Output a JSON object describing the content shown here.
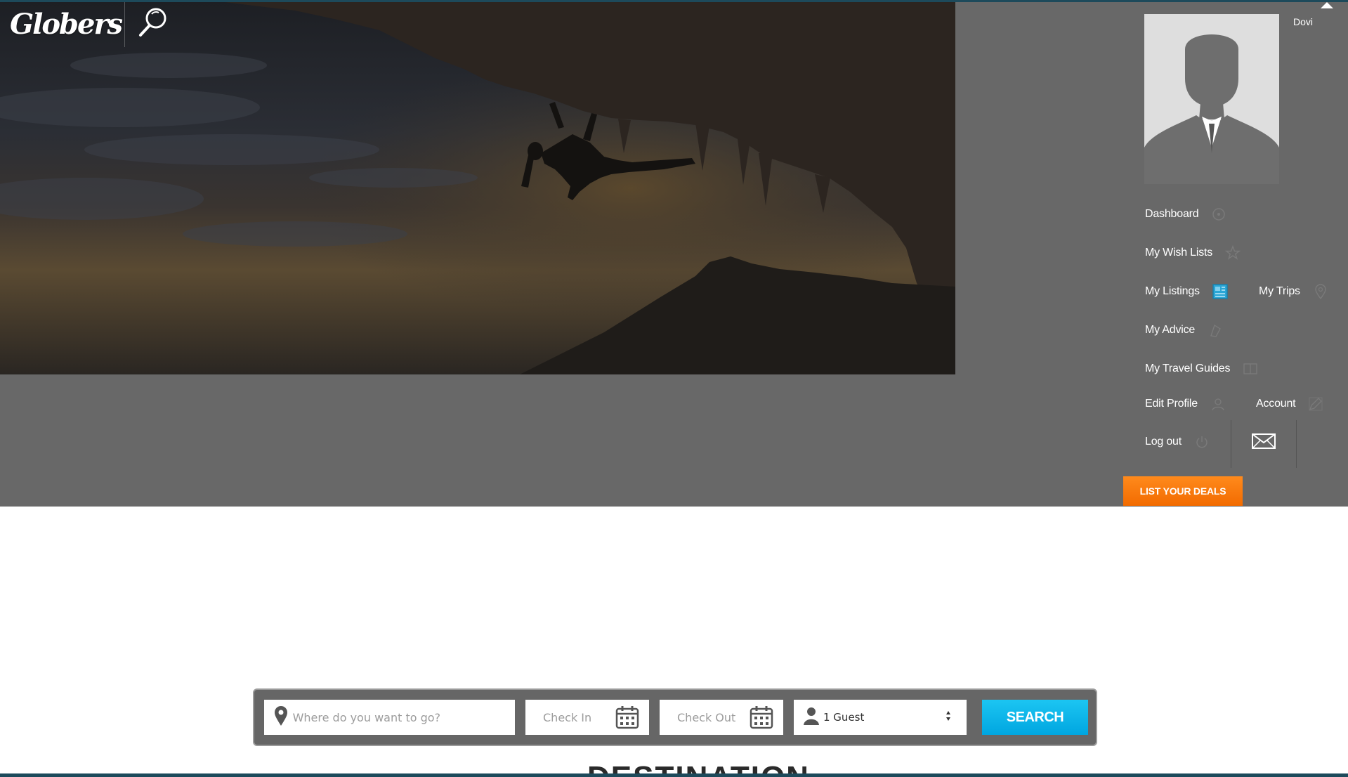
{
  "header": {
    "logo_text": "Globers"
  },
  "account_menu": {
    "username": "Dovi",
    "items": [
      {
        "label": "Dashboard",
        "icon": "gauge-icon"
      },
      {
        "label": "My Wish Lists",
        "icon": "star-icon"
      },
      {
        "label": "My Listings",
        "icon": "listing-icon"
      },
      {
        "label": "My Trips",
        "icon": "map-pin-icon"
      },
      {
        "label": "My Advice",
        "icon": "bookmark-icon"
      },
      {
        "label": "My Travel Guides",
        "icon": "book-icon"
      },
      {
        "label": "Edit Profile",
        "icon": "user-icon"
      },
      {
        "label": "Account",
        "icon": "pencil-icon"
      },
      {
        "label": "Log out",
        "icon": "power-icon"
      }
    ],
    "list_deals_label": "LIST YOUR DEALS"
  },
  "search": {
    "destination_placeholder": "Where do you want to go?",
    "check_in_placeholder": "Check In",
    "check_out_placeholder": "Check Out",
    "guests_value": "1 Guest",
    "button_label": "SEARCH"
  },
  "section": {
    "heading": "DESTINATION"
  },
  "colors": {
    "overlay": "#686868",
    "accent_orange": "#f26b00",
    "accent_blue": "#00a6e0",
    "top_strip": "#1d4a5b"
  }
}
